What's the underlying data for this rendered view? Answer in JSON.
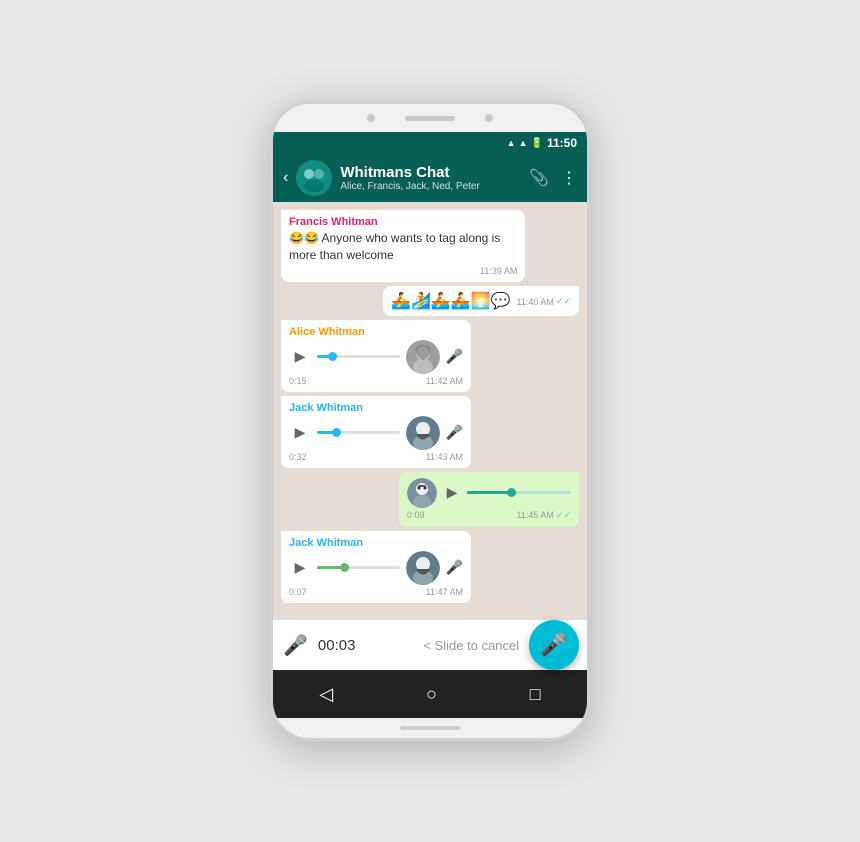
{
  "phone": {
    "status_bar": {
      "time": "11:50",
      "signal": "▲",
      "wifi": "▲",
      "battery": "▐"
    },
    "header": {
      "title": "Whitmans Chat",
      "subtitle": "Alice, Francis, Jack, Ned, Peter",
      "back_label": "‹",
      "attach_icon": "📎",
      "more_icon": "⋮"
    },
    "messages": [
      {
        "id": "msg1",
        "type": "text",
        "sender": "Francis Whitman",
        "sender_color": "#e91e63",
        "text": "😂😂 Anyone who wants to tag along is more than welcome",
        "time": "11:39 AM",
        "direction": "incoming"
      },
      {
        "id": "msg2",
        "type": "emoji",
        "text": "🚣🏄🚣🚣🌅💬",
        "time": "11:40 AM",
        "direction": "outgoing",
        "ticks": "✓✓"
      },
      {
        "id": "msg3",
        "type": "voice",
        "sender": "Alice Whitman",
        "sender_color": "#ff9800",
        "duration": "0:15",
        "time": "11:42 AM",
        "direction": "incoming",
        "avatar": "alice",
        "bar_fill": 15
      },
      {
        "id": "msg4",
        "type": "voice",
        "sender": "Jack Whitman",
        "sender_color": "#29b6f6",
        "duration": "0:32",
        "time": "11:43 AM",
        "direction": "incoming",
        "avatar": "jack",
        "bar_fill": 20
      },
      {
        "id": "msg5",
        "type": "voice_out",
        "duration": "0:09",
        "time": "11:45 AM",
        "direction": "outgoing",
        "ticks": "✓✓",
        "bar_fill": 40
      },
      {
        "id": "msg6",
        "type": "voice",
        "sender": "Jack Whitman",
        "sender_color": "#29b6f6",
        "duration": "0:07",
        "time": "11:47 AM",
        "direction": "incoming",
        "avatar": "jack",
        "bar_fill": 30
      }
    ],
    "recording": {
      "time": "00:03",
      "cancel_text": "< Slide to cancel"
    },
    "nav": {
      "back": "◁",
      "home": "○",
      "recent": "□"
    }
  }
}
